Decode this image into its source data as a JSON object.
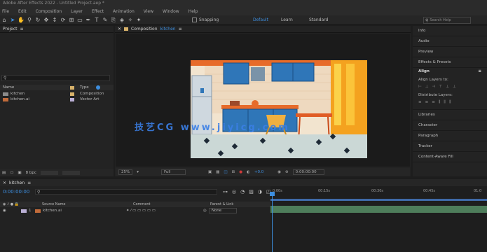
{
  "title_bar": {
    "text": "Adobe After Effects 2022 - Untitled Project.aep *"
  },
  "menu": [
    "File",
    "Edit",
    "Composition",
    "Layer",
    "Effect",
    "Animation",
    "View",
    "Window",
    "Help"
  ],
  "toolbar": {
    "snapping_label": "Snapping",
    "workspaces": [
      "Default",
      "Learn",
      "Standard"
    ],
    "search_placeholder": "Search Help",
    "accent": "#3d8fe0"
  },
  "project_panel": {
    "title": "Project",
    "columns": [
      "Name",
      "Type"
    ],
    "items": [
      {
        "name": "kitchen",
        "type": "Composition"
      },
      {
        "name": "kitchen.ai",
        "type": "Vector Art"
      }
    ],
    "bpc": "8 bpc"
  },
  "composition_panel": {
    "title": "Composition",
    "comp_name": "kitchen",
    "tab": "kitchen",
    "zoom": "25%",
    "quality": "Full",
    "exposure": "+0.0",
    "timecode": "0:00:00:00"
  },
  "right_panels": [
    "Info",
    "Audio",
    "Preview",
    "Effects & Presets",
    "Align",
    "Libraries",
    "Character",
    "Paragraph",
    "Tracker",
    "Content-Aware Fill"
  ],
  "align_panel": {
    "title": "Align",
    "align_layers_to": "Align Layers to:",
    "distribute_layers": "Distribute Layers:"
  },
  "timeline": {
    "tab": "kitchen",
    "timecode": "0:00:00:00",
    "columns": {
      "source_name": "Source Name",
      "comment": "Comment",
      "parent_link": "Parent & Link"
    },
    "layer": {
      "num": "1",
      "name": "kitchen.ai",
      "parent": "None"
    },
    "ruler_marks": [
      "0:00s",
      "00:15s",
      "00:30s",
      "00:45s",
      "01:0"
    ]
  },
  "watermark": "技艺CG www.jiyicg.com"
}
